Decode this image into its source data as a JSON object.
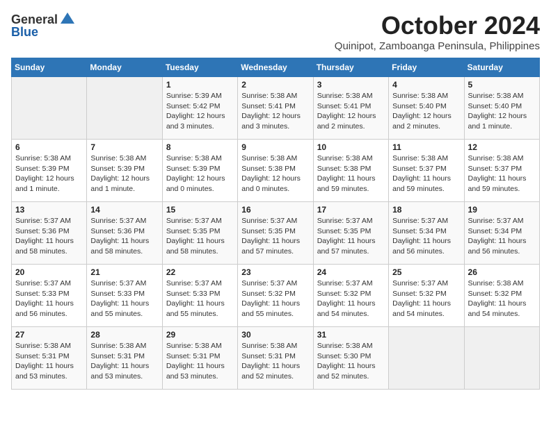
{
  "header": {
    "logo_general": "General",
    "logo_blue": "Blue",
    "month_title": "October 2024",
    "subtitle": "Quinipot, Zamboanga Peninsula, Philippines"
  },
  "days_of_week": [
    "Sunday",
    "Monday",
    "Tuesday",
    "Wednesday",
    "Thursday",
    "Friday",
    "Saturday"
  ],
  "weeks": [
    [
      {
        "day": "",
        "detail": ""
      },
      {
        "day": "",
        "detail": ""
      },
      {
        "day": "1",
        "detail": "Sunrise: 5:39 AM\nSunset: 5:42 PM\nDaylight: 12 hours\nand 3 minutes."
      },
      {
        "day": "2",
        "detail": "Sunrise: 5:38 AM\nSunset: 5:41 PM\nDaylight: 12 hours\nand 3 minutes."
      },
      {
        "day": "3",
        "detail": "Sunrise: 5:38 AM\nSunset: 5:41 PM\nDaylight: 12 hours\nand 2 minutes."
      },
      {
        "day": "4",
        "detail": "Sunrise: 5:38 AM\nSunset: 5:40 PM\nDaylight: 12 hours\nand 2 minutes."
      },
      {
        "day": "5",
        "detail": "Sunrise: 5:38 AM\nSunset: 5:40 PM\nDaylight: 12 hours\nand 1 minute."
      }
    ],
    [
      {
        "day": "6",
        "detail": "Sunrise: 5:38 AM\nSunset: 5:39 PM\nDaylight: 12 hours\nand 1 minute."
      },
      {
        "day": "7",
        "detail": "Sunrise: 5:38 AM\nSunset: 5:39 PM\nDaylight: 12 hours\nand 1 minute."
      },
      {
        "day": "8",
        "detail": "Sunrise: 5:38 AM\nSunset: 5:39 PM\nDaylight: 12 hours\nand 0 minutes."
      },
      {
        "day": "9",
        "detail": "Sunrise: 5:38 AM\nSunset: 5:38 PM\nDaylight: 12 hours\nand 0 minutes."
      },
      {
        "day": "10",
        "detail": "Sunrise: 5:38 AM\nSunset: 5:38 PM\nDaylight: 11 hours\nand 59 minutes."
      },
      {
        "day": "11",
        "detail": "Sunrise: 5:38 AM\nSunset: 5:37 PM\nDaylight: 11 hours\nand 59 minutes."
      },
      {
        "day": "12",
        "detail": "Sunrise: 5:38 AM\nSunset: 5:37 PM\nDaylight: 11 hours\nand 59 minutes."
      }
    ],
    [
      {
        "day": "13",
        "detail": "Sunrise: 5:37 AM\nSunset: 5:36 PM\nDaylight: 11 hours\nand 58 minutes."
      },
      {
        "day": "14",
        "detail": "Sunrise: 5:37 AM\nSunset: 5:36 PM\nDaylight: 11 hours\nand 58 minutes."
      },
      {
        "day": "15",
        "detail": "Sunrise: 5:37 AM\nSunset: 5:35 PM\nDaylight: 11 hours\nand 58 minutes."
      },
      {
        "day": "16",
        "detail": "Sunrise: 5:37 AM\nSunset: 5:35 PM\nDaylight: 11 hours\nand 57 minutes."
      },
      {
        "day": "17",
        "detail": "Sunrise: 5:37 AM\nSunset: 5:35 PM\nDaylight: 11 hours\nand 57 minutes."
      },
      {
        "day": "18",
        "detail": "Sunrise: 5:37 AM\nSunset: 5:34 PM\nDaylight: 11 hours\nand 56 minutes."
      },
      {
        "day": "19",
        "detail": "Sunrise: 5:37 AM\nSunset: 5:34 PM\nDaylight: 11 hours\nand 56 minutes."
      }
    ],
    [
      {
        "day": "20",
        "detail": "Sunrise: 5:37 AM\nSunset: 5:33 PM\nDaylight: 11 hours\nand 56 minutes."
      },
      {
        "day": "21",
        "detail": "Sunrise: 5:37 AM\nSunset: 5:33 PM\nDaylight: 11 hours\nand 55 minutes."
      },
      {
        "day": "22",
        "detail": "Sunrise: 5:37 AM\nSunset: 5:33 PM\nDaylight: 11 hours\nand 55 minutes."
      },
      {
        "day": "23",
        "detail": "Sunrise: 5:37 AM\nSunset: 5:32 PM\nDaylight: 11 hours\nand 55 minutes."
      },
      {
        "day": "24",
        "detail": "Sunrise: 5:37 AM\nSunset: 5:32 PM\nDaylight: 11 hours\nand 54 minutes."
      },
      {
        "day": "25",
        "detail": "Sunrise: 5:37 AM\nSunset: 5:32 PM\nDaylight: 11 hours\nand 54 minutes."
      },
      {
        "day": "26",
        "detail": "Sunrise: 5:38 AM\nSunset: 5:32 PM\nDaylight: 11 hours\nand 54 minutes."
      }
    ],
    [
      {
        "day": "27",
        "detail": "Sunrise: 5:38 AM\nSunset: 5:31 PM\nDaylight: 11 hours\nand 53 minutes."
      },
      {
        "day": "28",
        "detail": "Sunrise: 5:38 AM\nSunset: 5:31 PM\nDaylight: 11 hours\nand 53 minutes."
      },
      {
        "day": "29",
        "detail": "Sunrise: 5:38 AM\nSunset: 5:31 PM\nDaylight: 11 hours\nand 53 minutes."
      },
      {
        "day": "30",
        "detail": "Sunrise: 5:38 AM\nSunset: 5:31 PM\nDaylight: 11 hours\nand 52 minutes."
      },
      {
        "day": "31",
        "detail": "Sunrise: 5:38 AM\nSunset: 5:30 PM\nDaylight: 11 hours\nand 52 minutes."
      },
      {
        "day": "",
        "detail": ""
      },
      {
        "day": "",
        "detail": ""
      }
    ]
  ]
}
